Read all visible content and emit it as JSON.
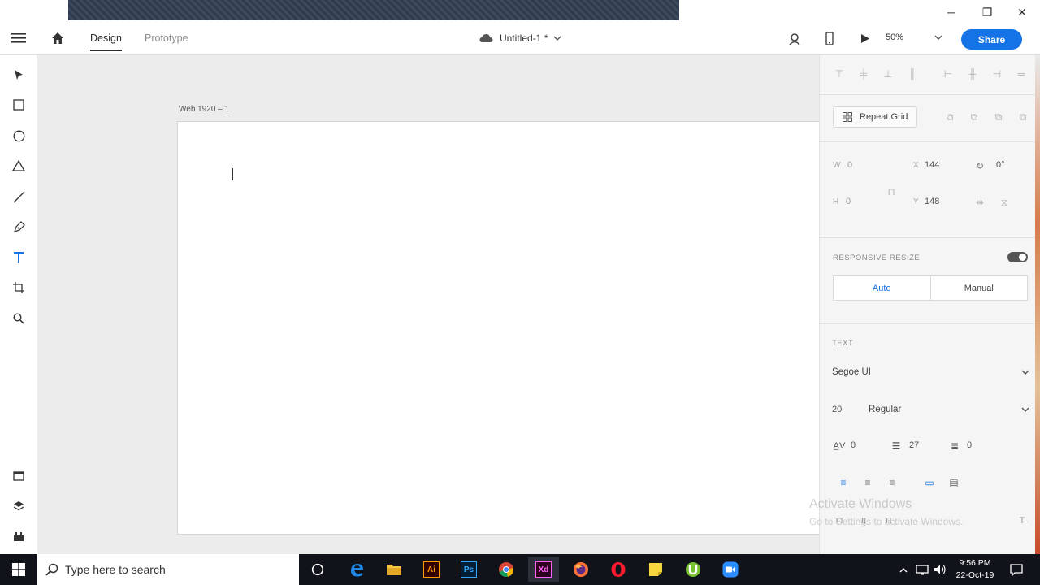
{
  "window": {
    "minimize_glyph": "─",
    "restore_glyph": "❐",
    "close_glyph": "✕"
  },
  "toolbar": {
    "tabs": [
      {
        "label": "Design",
        "active": true
      },
      {
        "label": "Prototype",
        "active": false
      }
    ],
    "document_title": "Untitled-1 *",
    "zoom": "50%",
    "share_label": "Share"
  },
  "canvas": {
    "artboard_name": "Web 1920 – 1"
  },
  "properties": {
    "repeat_grid_label": "Repeat Grid",
    "w_label": "W",
    "w_value": "0",
    "h_label": "H",
    "h_value": "0",
    "x_label": "X",
    "x_value": "144",
    "y_label": "Y",
    "y_value": "148",
    "rotation_value": "0°",
    "responsive_resize_label": "RESPONSIVE RESIZE",
    "responsive_resize_on": true,
    "resize_auto": "Auto",
    "resize_manual": "Manual",
    "text_section_label": "TEXT",
    "font_family": "Segoe UI",
    "font_size": "20",
    "font_weight": "Regular",
    "char_spacing": "0",
    "line_spacing": "27",
    "paragraph_spacing": "0"
  },
  "watermark": {
    "line1": "Activate Windows",
    "line2": "Go to Settings to activate Windows."
  },
  "taskbar": {
    "search_placeholder": "Type here to search",
    "time": "9:56 PM",
    "date": "22-Oct-19",
    "apps": [
      "cortana",
      "edge",
      "file-explorer",
      "illustrator",
      "photoshop",
      "chrome",
      "xd",
      "firefox",
      "opera",
      "sticky-notes",
      "utorrent",
      "zoom"
    ],
    "illustrator_label": "Ai",
    "photoshop_label": "Ps",
    "xd_label": "Xd"
  },
  "colors": {
    "accent": "#1473e6",
    "tool_active": "#1473e6",
    "xd_brand": "#ff61f6",
    "ai_brand": "#ff9a00",
    "ps_brand": "#31a8ff"
  }
}
